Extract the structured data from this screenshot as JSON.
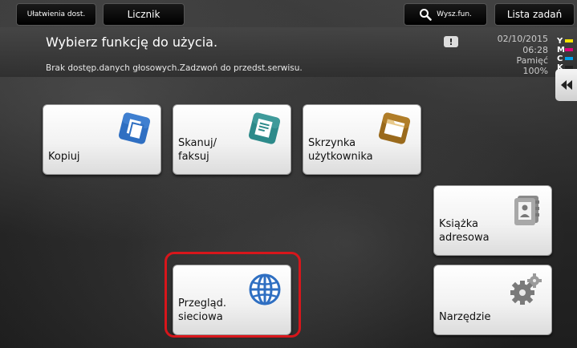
{
  "top_bar": {
    "settings_label": "Ułatwienia dost.",
    "counter_label": "Licznik",
    "search_label": "Wysz.fun.",
    "jobs_label": "Lista zadań"
  },
  "message": {
    "title": "Wybierz funkcję do użycia.",
    "subtitle": "Brak dostęp.danych głosowych.Zadzwoń do przedst.serwisu.",
    "warning_glyph": "!"
  },
  "status": {
    "date": "02/10/2015",
    "time": "06:28",
    "memory_label": "Pamięć",
    "memory_value": "100%"
  },
  "toner": [
    {
      "letter": "Y",
      "color": "#f5e400"
    },
    {
      "letter": "M",
      "color": "#e2007a"
    },
    {
      "letter": "C",
      "color": "#00a0e9"
    },
    {
      "letter": "K",
      "color": "#222222"
    }
  ],
  "tiles": {
    "copy": "Kopiuj",
    "scan": "Skanuj/\nfaksuj",
    "box": "Skrzynka\nużytkownika",
    "address_book": "Książka\nadresowa",
    "web_browser": "Przegląd.\nsieciowa",
    "tools": "Narzędzie"
  },
  "colors": {
    "highlight": "#d8161b",
    "icon_blue": "#2f6fc2",
    "icon_teal": "#2d8a8a",
    "icon_brown": "#9a6a1c",
    "icon_gray": "#8a8a8a"
  }
}
